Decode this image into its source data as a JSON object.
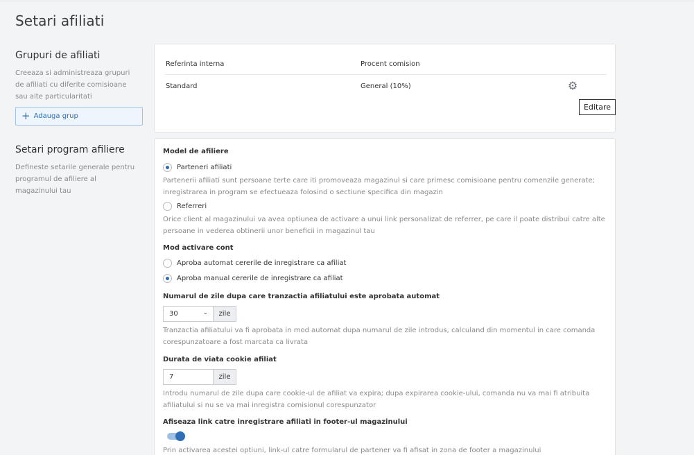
{
  "page": {
    "title": "Setari afiliati"
  },
  "groups_section": {
    "title": "Grupuri de afiliati",
    "description": "Creeaza si administreaza grupuri de afiliati cu diferite comisioane sau alte particularitati",
    "add_button": "Adauga grup"
  },
  "groups_table": {
    "columns": [
      "Referinta interna",
      "Procent comision"
    ],
    "rows": [
      {
        "reference": "Standard",
        "commission": "General (10%)"
      }
    ],
    "tooltip": "Editare"
  },
  "program_section": {
    "title": "Setari program afiliere",
    "description": "Defineste setarile generale pentru programul de afiliere al magazinului tau"
  },
  "settings": {
    "model_label": "Model de afiliere",
    "model_options": [
      {
        "label": "Parteneri afiliati",
        "checked": true,
        "help": "Partenerii afiliati sunt persoane terte care iti promoveaza magazinul si care primesc comisioane pentru comenzile generate; inregistrarea in program se efectueaza folosind o sectiune specifica din magazin"
      },
      {
        "label": "Referreri",
        "checked": false,
        "help": "Orice client al magazinului va avea optiunea de activare a unui link personalizat de referrer, pe care il poate distribui catre alte persoane in vederea obtinerii unor beneficii in magazinul tau"
      }
    ],
    "activation_label": "Mod activare cont",
    "activation_options": [
      {
        "label": "Aproba automat cererile de inregistrare ca afiliat",
        "checked": false
      },
      {
        "label": "Aproba manual cererile de inregistrare ca afiliat",
        "checked": true
      }
    ],
    "days_label": "Numarul de zile dupa care tranzactia afiliatului este aprobata automat",
    "days_value": "30",
    "days_unit": "zile",
    "days_help": "Tranzactia afiliatului va fi aprobata in mod automat dupa numarul de zile introdus, calculand din momentul in care comanda corespunzatoare a fost marcata ca livrata",
    "cookie_label": "Durata de viata cookie afiliat",
    "cookie_value": "7",
    "cookie_unit": "zile",
    "cookie_help": "Introdu numarul de zile dupa care cookie-ul de afiliat va expira; dupa expirarea cookie-ului, comanda nu va mai fi atribuita afiliatului si nu se va mai inregistra comisionul corespunzator",
    "footer_link_label": "Afiseaza link catre inregistrare afiliati in footer-ul magazinului",
    "footer_link_enabled": true,
    "footer_link_help": "Prin activarea acestei optiuni, link-ul catre formularul de partener va fi afisat in zona de footer a magazinului"
  },
  "icons": {
    "add": "plus-icon",
    "edit": "gear-icon",
    "dropdown": "chevron-down-icon"
  },
  "colors": {
    "accent": "#2f6eb5",
    "background": "#f3f4f6"
  }
}
